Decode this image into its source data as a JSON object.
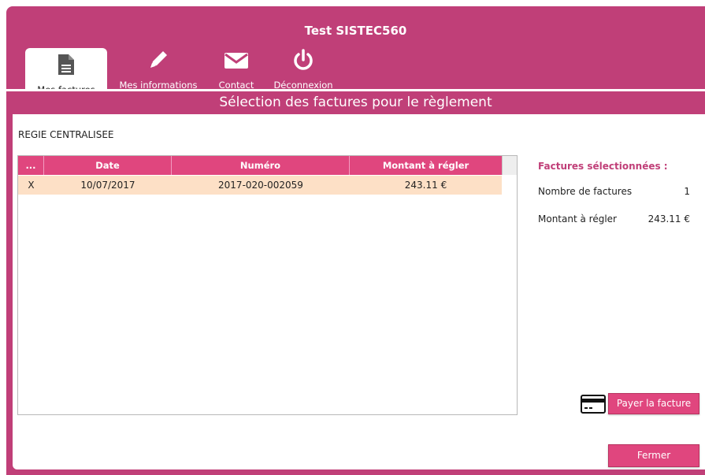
{
  "app": {
    "title": "Test SISTEC560"
  },
  "nav": {
    "tabs": [
      {
        "label": "Mes factures",
        "icon": "document-icon",
        "active": true
      },
      {
        "label": "Mes informations",
        "icon": "pencil-icon",
        "active": false
      },
      {
        "label": "Contact",
        "icon": "envelope-icon",
        "active": false
      },
      {
        "label": "Déconnexion",
        "icon": "power-icon",
        "active": false
      }
    ]
  },
  "section": {
    "title": "Sélection des factures pour le règlement"
  },
  "regie": {
    "label": "REGIE CENTRALISEE"
  },
  "table": {
    "columns": [
      "...",
      "Date",
      "Numéro",
      "Montant à régler"
    ],
    "rows": [
      {
        "select": "X",
        "date": "10/07/2017",
        "numero": "2017-020-002059",
        "montant": "243.11 €"
      }
    ]
  },
  "summary": {
    "title": "Factures sélectionnées :",
    "count_label": "Nombre de factures",
    "count_value": "1",
    "amount_label": "Montant à régler",
    "amount_value": "243.11 €"
  },
  "actions": {
    "pay_label": "Payer la facture",
    "close_label": "Fermer"
  },
  "colors": {
    "brand": "#c03f78",
    "header_accent": "#e0467e",
    "row_selected": "#fde0c6"
  }
}
